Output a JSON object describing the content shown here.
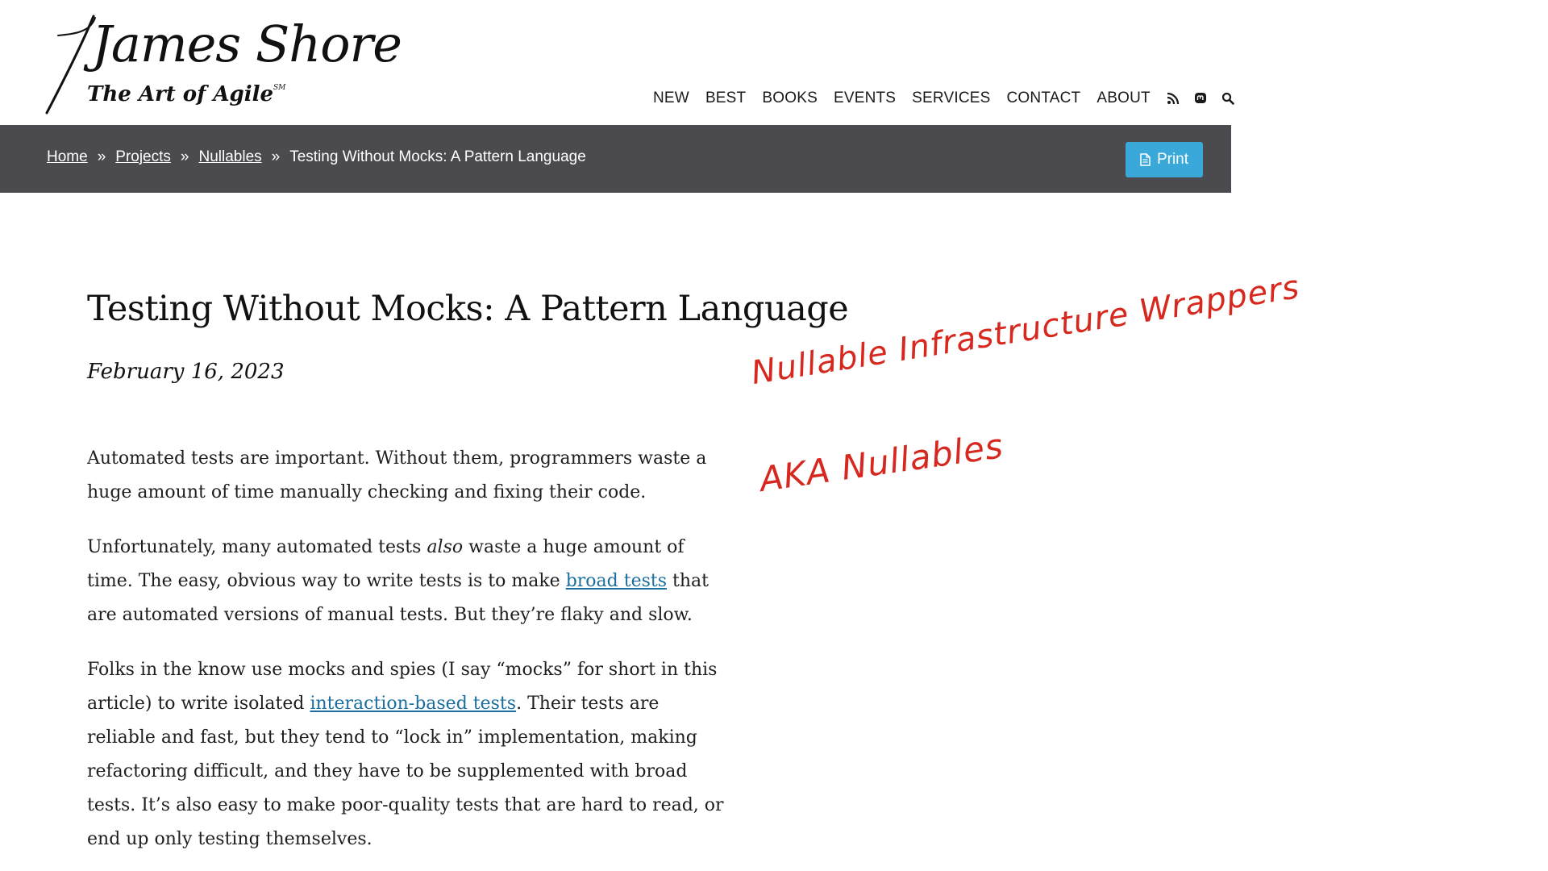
{
  "header": {
    "logo_name": "James Shore",
    "logo_tagline": "The Art of Agile",
    "logo_mark": "SM",
    "nav": [
      {
        "label": "NEW"
      },
      {
        "label": "BEST"
      },
      {
        "label": "BOOKS"
      },
      {
        "label": "EVENTS"
      },
      {
        "label": "SERVICES"
      },
      {
        "label": "CONTACT"
      },
      {
        "label": "ABOUT"
      }
    ],
    "icons": [
      "rss-icon",
      "mastodon-icon",
      "search-icon"
    ]
  },
  "breadcrumb": {
    "items": [
      {
        "label": "Home"
      },
      {
        "label": "Projects"
      },
      {
        "label": "Nullables"
      }
    ],
    "separator": "»",
    "current": "Testing Without Mocks: A Pattern Language",
    "print_label": "Print"
  },
  "article": {
    "title": "Testing Without Mocks: A Pattern Language",
    "date": "February 16, 2023",
    "p1": "Automated tests are important. Without them, programmers waste a huge amount of time manually checking and fixing their code.",
    "p2_a": "Unfortunately, many automated tests ",
    "p2_em": "also",
    "p2_b": " waste a huge amount of time. The easy, obvious way to write tests is to make ",
    "p2_link": "broad tests",
    "p2_c": " that are automated versions of manual tests. But they’re flaky and slow.",
    "p3_a": "Folks in the know use mocks and spies (I say “mocks” for short in this article) to write isolated ",
    "p3_link": "interaction-based tests",
    "p3_b": ". Their tests are reliable and fast, but they tend to “lock in” implementation, making refactoring difficult, and they have to be supplemented with broad tests. It’s also easy to make poor-quality tests that are hard to read, or end up only testing themselves."
  },
  "annotation": {
    "line1": "Nullable Infrastructure Wrappers",
    "line2": "AKA Nullables",
    "color": "#d6281e"
  },
  "colors": {
    "breadcrumb_bg": "#4b4b4f",
    "print_button": "#3aa8d8",
    "link": "#1a6fa0"
  }
}
